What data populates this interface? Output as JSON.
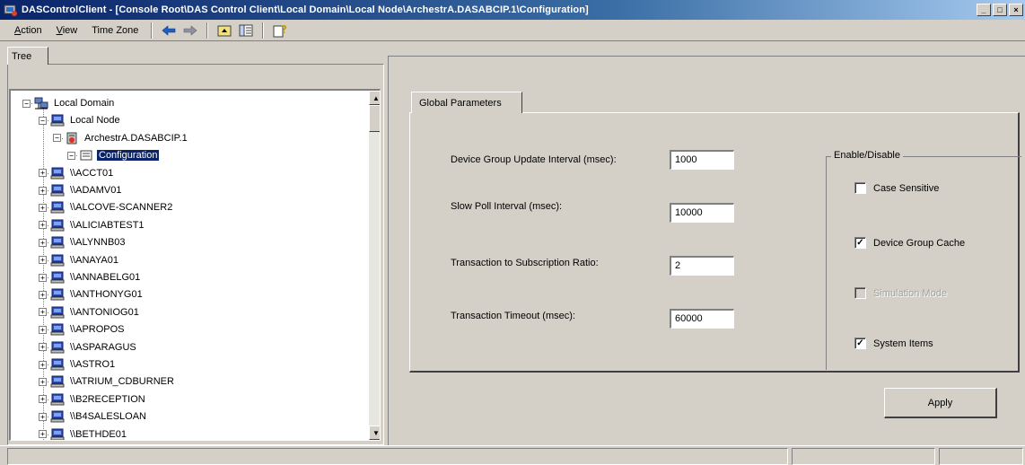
{
  "window": {
    "title": "DASControlClient - [Console Root\\DAS Control Client\\Local Domain\\Local Node\\ArchestrA.DASABCIP.1\\Configuration]",
    "buttons": {
      "minimize": "_",
      "maximize": "□",
      "close": "×"
    }
  },
  "menu": {
    "items": [
      {
        "label": "Action",
        "accel": "A",
        "rest": "ction"
      },
      {
        "label": "View",
        "accel": "V",
        "rest": "iew"
      },
      {
        "label": "Time Zone",
        "accel": "",
        "rest": "Time Zone"
      }
    ]
  },
  "toolbar": {
    "icons": [
      "back-arrow-icon",
      "forward-arrow-icon",
      "up-folder-icon",
      "show-hide-tree-icon",
      "help-icon"
    ]
  },
  "tree": {
    "tab_label": "Tree",
    "nodes": [
      {
        "label": "Local Domain",
        "icon": "domain-icon",
        "expander": "−"
      },
      {
        "label": "Local Node",
        "icon": "computer-icon",
        "expander": "−"
      },
      {
        "label": "ArchestrA.DASABCIP.1",
        "icon": "server-icon",
        "expander": "−"
      },
      {
        "label": "Configuration",
        "icon": "configuration-icon",
        "expander": "−",
        "selected": true
      },
      {
        "label": "\\\\ACCT01",
        "icon": "computer-icon",
        "expander": "+"
      },
      {
        "label": "\\\\ADAMV01",
        "icon": "computer-icon",
        "expander": "+"
      },
      {
        "label": "\\\\ALCOVE-SCANNER2",
        "icon": "computer-icon",
        "expander": "+"
      },
      {
        "label": "\\\\ALICIABTEST1",
        "icon": "computer-icon",
        "expander": "+"
      },
      {
        "label": "\\\\ALYNNB03",
        "icon": "computer-icon",
        "expander": "+"
      },
      {
        "label": "\\\\ANAYA01",
        "icon": "computer-icon",
        "expander": "+"
      },
      {
        "label": "\\\\ANNABELG01",
        "icon": "computer-icon",
        "expander": "+"
      },
      {
        "label": "\\\\ANTHONYG01",
        "icon": "computer-icon",
        "expander": "+"
      },
      {
        "label": "\\\\ANTONIOG01",
        "icon": "computer-icon",
        "expander": "+"
      },
      {
        "label": "\\\\APROPOS",
        "icon": "computer-icon",
        "expander": "+"
      },
      {
        "label": "\\\\ASPARAGUS",
        "icon": "computer-icon",
        "expander": "+"
      },
      {
        "label": "\\\\ASTRO1",
        "icon": "computer-icon",
        "expander": "+"
      },
      {
        "label": "\\\\ATRIUM_CDBURNER",
        "icon": "computer-icon",
        "expander": "+"
      },
      {
        "label": "\\\\B2RECEPTION",
        "icon": "computer-icon",
        "expander": "+"
      },
      {
        "label": "\\\\B4SALESLOAN",
        "icon": "computer-icon",
        "expander": "+"
      },
      {
        "label": "\\\\BETHDE01",
        "icon": "computer-icon",
        "expander": "+"
      }
    ]
  },
  "config": {
    "tab_label": "Global Parameters",
    "fields": [
      {
        "label": "Device Group Update Interval (msec):",
        "value": "1000"
      },
      {
        "label": "Slow Poll Interval (msec):",
        "value": "10000"
      },
      {
        "label": "Transaction to Subscription Ratio:",
        "value": "2"
      },
      {
        "label": "Transaction Timeout (msec):",
        "value": "60000"
      }
    ],
    "group_title": "Enable/Disable",
    "checkboxes": [
      {
        "label": "Case Sensitive",
        "checked": false,
        "enabled": true
      },
      {
        "label": "Device Group Cache",
        "checked": true,
        "enabled": true
      },
      {
        "label": "Simulation Mode",
        "checked": false,
        "enabled": false
      },
      {
        "label": "System Items",
        "checked": true,
        "enabled": true
      }
    ],
    "apply_label": "Apply",
    "check_mark": "✓"
  },
  "colors": {
    "titlebar_start": "#0a246a",
    "titlebar_end": "#a6caf0",
    "selection": "#0a246a",
    "face": "#d4d0c8"
  }
}
